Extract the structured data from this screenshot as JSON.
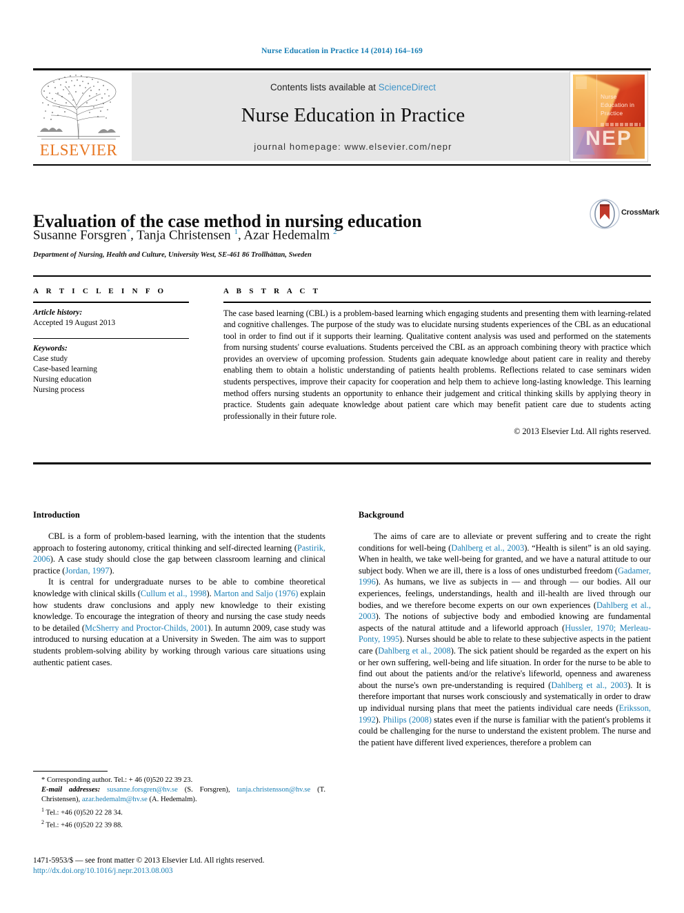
{
  "running_head": "Nurse Education in Practice 14 (2014) 164–169",
  "masthead": {
    "contents_prefix": "Contents lists available at ",
    "sciencedirect": "ScienceDirect",
    "journal_name": "Nurse Education in Practice",
    "homepage": "journal homepage: www.elsevier.com/nepr",
    "publisher_wordmark": "ELSEVIER",
    "cover_title": "Nurse Education in Practice",
    "cover_abbrev": "NEP",
    "link_color": "#3f94c8",
    "wordmark_color": "#E87722"
  },
  "article": {
    "title": "Evaluation of the case method in nursing education",
    "authors_html": "Susanne Forsgren<sup>*</sup>, Tanja Christensen <sup>1</sup>, Azar Hedemalm <sup>2</sup>",
    "affiliation": "Department of Nursing, Health and Culture, University West, SE-461 86 Trollhättan, Sweden",
    "crossmark_label": "CrossMark"
  },
  "info": {
    "heading": "A R T I C L E   I N F O",
    "history_label": "Article history:",
    "history_value": "Accepted 19 August 2013",
    "keywords_label": "Keywords:",
    "keywords": [
      "Case study",
      "Case-based learning",
      "Nursing education",
      "Nursing process"
    ]
  },
  "abstract": {
    "heading": "A B S T R A C T",
    "text": "The case based learning (CBL) is a problem-based learning which engaging students and presenting them with learning-related and cognitive challenges. The purpose of the study was to elucidate nursing students experiences of the CBL as an educational tool in order to find out if it supports their learning. Qualitative content analysis was used and performed on the statements from nursing students' course evaluations. Students perceived the CBL as an approach combining theory with practice which provides an overview of upcoming profession. Students gain adequate knowledge about patient care in reality and thereby enabling them to obtain a holistic understanding of patients health problems. Reflections related to case seminars widen students perspectives, improve their capacity for cooperation and help them to achieve long-lasting knowledge. This learning method offers nursing students an opportunity to enhance their judgement and critical thinking skills by applying theory in practice. Students gain adequate knowledge about patient care which may benefit patient care due to students acting professionally in their future role.",
    "copyright": "© 2013 Elsevier Ltd. All rights reserved."
  },
  "introduction": {
    "heading": "Introduction",
    "paragraph_1_html": "CBL is a form of problem-based learning, with the intention that the students approach to fostering autonomy, critical thinking and self-directed learning (<span class=\"ref\">Pastirik, 2006</span>). A case study should close the gap between classroom learning and clinical practice (<span class=\"ref\">Jordan, 1997</span>).",
    "paragraph_2_html": "It is central for undergraduate nurses to be able to combine theoretical knowledge with clinical skills (<span class=\"ref\">Cullum et al., 1998</span>). <span class=\"ref\">Marton and Saljo (1976)</span> explain how students draw conclusions and apply new knowledge to their existing knowledge. To encourage the integration of theory and nursing the case study needs to be detailed (<span class=\"ref\">McSherry and Proctor-Childs, 2001</span>). In autumn 2009, case study was introduced to nursing education at a University in Sweden. The aim was to support students problem-solving ability by working through various care situations using authentic patient cases."
  },
  "background": {
    "heading": "Background",
    "paragraph_1_html": "The aims of care are to alleviate or prevent suffering and to create the right conditions for well-being (<span class=\"ref\">Dahlberg et al., 2003</span>). “Health is silent” is an old saying. When in health, we take well-being for granted, and we have a natural attitude to our subject body. When we are ill, there is a loss of ones undisturbed freedom (<span class=\"ref\">Gadamer, 1996</span>). As humans, we live as subjects in — and through — our bodies. All our experiences, feelings, understandings, health and ill-health are lived through our bodies, and we therefore become experts on our own experiences (<span class=\"ref\">Dahlberg et al., 2003</span>). The notions of subjective body and embodied knowing are fundamental aspects of the natural attitude and a lifeworld approach (<span class=\"ref\">Hussler, 1970; Merleau-Ponty, 1995</span>). Nurses should be able to relate to these subjective aspects in the patient care (<span class=\"ref\">Dahlberg et al., 2008</span>). The sick patient should be regarded as the expert on his or her own suffering, well-being and life situation. In order for the nurse to be able to find out about the patients and/or the relative's lifeworld, openness and awareness about the nurse's own pre-understanding is required (<span class=\"ref\">Dahlberg et al., 2003</span>). It is therefore important that nurses work consciously and systematically in order to draw up individual nursing plans that meet the patients individual care needs (<span class=\"ref\">Eriksson, 1992</span>). <span class=\"ref\">Philips (2008)</span> states even if the nurse is familiar with the patient's problems it could be challenging for the nurse to understand the existent problem. The nurse and the patient have different lived experiences, therefore a problem can"
  },
  "footnotes": {
    "corresponding_html": "* Corresponding author. Tel.: + 46 (0)520 22 39 23.",
    "email_html": "<span class=\"fn-italic\">E-mail addresses:</span> <span class=\"mail\">susanne.forsgren@hv.se</span> (S. Forsgren), <span class=\"mail\">tanja.christensson@hv.se</span> (T. Christensen), <span class=\"mail\">azar.hedemalm@hv.se</span> (A. Hedemalm).",
    "note_1_html": "<sup class=\"fn-sup\">1</sup> Tel.: +46 (0)520 22 28 34.",
    "note_2_html": "<sup class=\"fn-sup\">2</sup> Tel.: +46 (0)520 22 39 88."
  },
  "issn": {
    "line_1": "1471-5953/$ — see front matter © 2013 Elsevier Ltd. All rights reserved.",
    "doi": "http://dx.doi.org/10.1016/j.nepr.2013.08.003"
  }
}
